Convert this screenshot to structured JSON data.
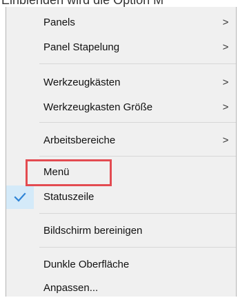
{
  "caption": {
    "partial_text": "Einblenden wird die Option M"
  },
  "menu": {
    "items": [
      {
        "label": "Panels",
        "submenu_indicator": ">"
      },
      {
        "label": "Panel Stapelung",
        "submenu_indicator": ">"
      },
      {
        "label": "Werkzeugkästen",
        "submenu_indicator": ">"
      },
      {
        "label": "Werkzeugkasten Größe",
        "submenu_indicator": ">"
      },
      {
        "label": "Arbeitsbereiche",
        "submenu_indicator": ">"
      },
      {
        "label": "Menü",
        "highlighted_by_annotation": true
      },
      {
        "label": "Statuszeile",
        "checked": true
      },
      {
        "label": "Bildschirm bereinigen"
      },
      {
        "label": "Dunkle Oberfläche"
      },
      {
        "label": "Anpassen..."
      }
    ]
  },
  "colors": {
    "menu_background": "#f0f0f0",
    "checked_background": "#d4eaf9",
    "checkmark": "#2f84d6",
    "annotation_outline": "#e34b51"
  },
  "icons": {
    "checkmark": "checkmark-icon",
    "submenu": "chevron-right-icon"
  }
}
